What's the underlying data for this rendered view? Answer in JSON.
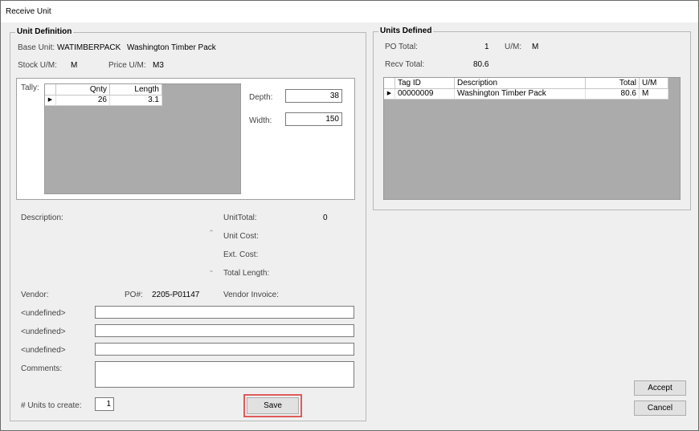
{
  "window": {
    "title": "Receive Unit"
  },
  "unit_definition": {
    "group_title": "Unit Definition",
    "base_unit_label": "Base Unit:",
    "base_unit_code": "WATIMBERPACK",
    "base_unit_name": "Washington Timber Pack",
    "stock_um_label": "Stock U/M:",
    "stock_um_value": "M",
    "price_um_label": "Price U/M:",
    "price_um_value": "M3",
    "tally_label": "Tally:",
    "tally_grid": {
      "columns": [
        "Qnty",
        "Length"
      ],
      "rows": [
        {
          "qnty": "26",
          "length": "3.1"
        }
      ]
    },
    "depth_label": "Depth:",
    "depth_value": "38",
    "width_label": "Width:",
    "width_value": "150",
    "description_label": "Description:",
    "unit_total_label": "UnitTotal:",
    "unit_total_value": "0",
    "unit_cost_label": "Unit Cost:",
    "ext_cost_label": "Ext. Cost:",
    "total_length_label": "Total Length:",
    "vendor_label": "Vendor:",
    "po_label": "PO#:",
    "po_value": "2205-P01147",
    "vendor_invoice_label": "Vendor Invoice:",
    "undefined_fields": [
      {
        "label": "<undefined>",
        "value": ""
      },
      {
        "label": "<undefined>",
        "value": ""
      },
      {
        "label": "<undefined>",
        "value": ""
      }
    ],
    "comments_label": "Comments:",
    "comments_value": "",
    "units_to_create_label": "# Units to create:",
    "units_to_create_value": "1",
    "save_label": "Save"
  },
  "units_defined": {
    "group_title": "Units Defined",
    "po_total_label": "PO Total:",
    "po_total_value": "1",
    "um_label": "U/M:",
    "um_value": "M",
    "recv_total_label": "Recv Total:",
    "recv_total_value": "80.6",
    "grid": {
      "columns": [
        "Tag ID",
        "Description",
        "Total",
        "U/M"
      ],
      "rows": [
        {
          "tag_id": "00000009",
          "description": "Washington Timber Pack",
          "total": "80.6",
          "um": "M"
        }
      ]
    }
  },
  "actions": {
    "accept_label": "Accept",
    "cancel_label": "Cancel"
  },
  "colors": {
    "highlight_border": "#e05a5a",
    "grid_empty_area": "#ababab"
  }
}
